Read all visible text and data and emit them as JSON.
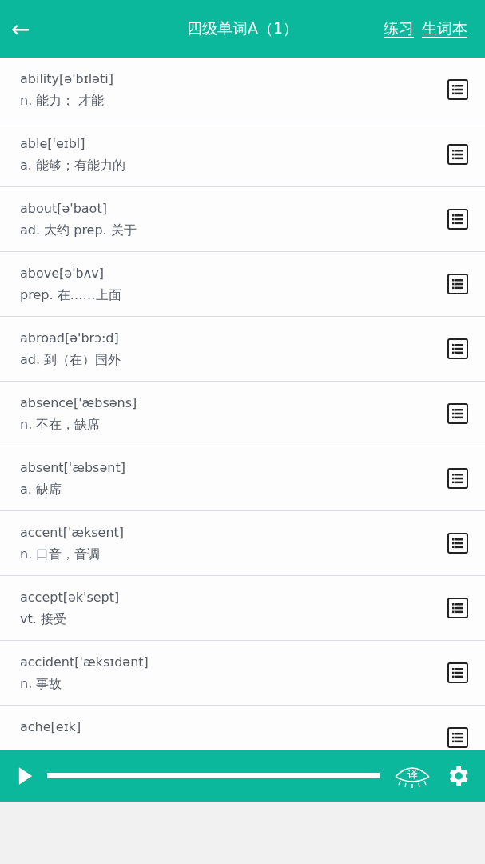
{
  "header": {
    "back": "←",
    "title": "四级单词A（1）",
    "links": [
      "练习",
      "生词本"
    ]
  },
  "words": [
    {
      "word": "ability[ə'bɪləti]",
      "definition": "n. 能力； 才能"
    },
    {
      "word": "able['eɪbl]",
      "definition": "a. 能够；有能力的"
    },
    {
      "word": "about[ə'baʊt]",
      "definition": "ad. 大约 prep. 关于"
    },
    {
      "word": "above[ə'bʌv]",
      "definition": "prep. 在……上面"
    },
    {
      "word": "abroad[ə'brɔ:d]",
      "definition": "ad. 到（在）国外"
    },
    {
      "word": "absence['æbsəns]",
      "definition": "n. 不在，缺席"
    },
    {
      "word": "absent['æbsənt]",
      "definition": "a. 缺席"
    },
    {
      "word": "accent['æksent]",
      "definition": "n. 口音，音调"
    },
    {
      "word": "accept[ək'sept]",
      "definition": "vt. 接受"
    },
    {
      "word": "accident['æksɪdənt]",
      "definition": "n. 事故"
    },
    {
      "word": "ache[eɪk]"
    }
  ],
  "player": {
    "translate_label": "译"
  }
}
